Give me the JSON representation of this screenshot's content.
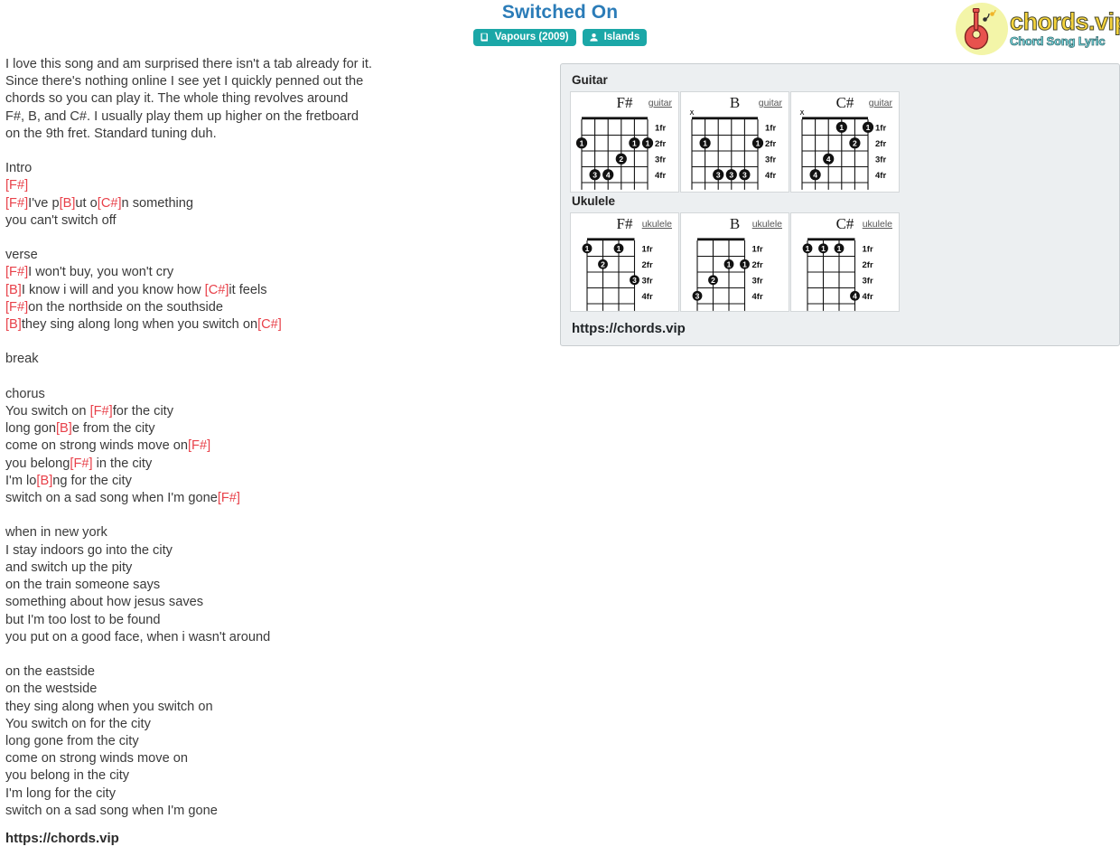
{
  "header": {
    "title": "Switched On",
    "badges": [
      {
        "icon": "album-icon",
        "label": "Vapours (2009)"
      },
      {
        "icon": "artist-icon",
        "label": "Islands"
      }
    ],
    "logo": {
      "icon": "guitar-icon",
      "name": "chords.vip",
      "tagline": "Chord Song Lyric"
    }
  },
  "lyrics": {
    "lines": [
      [
        {
          "t": "I love this song and am surprised there isn't a tab already for it.",
          "c": false
        }
      ],
      [
        {
          "t": "Since there's nothing online I see yet I quickly penned out the",
          "c": false
        }
      ],
      [
        {
          "t": "chords so you can play it. The whole thing revolves around",
          "c": false
        }
      ],
      [
        {
          "t": "F#, B, and C#. I usually play them up higher on the fretboard",
          "c": false
        }
      ],
      [
        {
          "t": "on the 9th fret. Standard tuning duh.",
          "c": false
        }
      ],
      [],
      [
        {
          "t": "Intro",
          "c": false
        }
      ],
      [
        {
          "t": "[F#]",
          "c": true
        }
      ],
      [
        {
          "t": "[F#]",
          "c": true
        },
        {
          "t": "I've p",
          "c": false
        },
        {
          "t": "[B]",
          "c": true
        },
        {
          "t": "ut o",
          "c": false
        },
        {
          "t": "[C#]",
          "c": true
        },
        {
          "t": "n something",
          "c": false
        }
      ],
      [
        {
          "t": "you can't switch off",
          "c": false
        }
      ],
      [],
      [
        {
          "t": "verse",
          "c": false
        }
      ],
      [
        {
          "t": "[F#]",
          "c": true
        },
        {
          "t": "I won't buy, you won't cry",
          "c": false
        }
      ],
      [
        {
          "t": "[B]",
          "c": true
        },
        {
          "t": "I know i will and you know how ",
          "c": false
        },
        {
          "t": "[C#]",
          "c": true
        },
        {
          "t": "it feels",
          "c": false
        }
      ],
      [
        {
          "t": "[F#]",
          "c": true
        },
        {
          "t": "on the northside on the southside",
          "c": false
        }
      ],
      [
        {
          "t": "[B]",
          "c": true
        },
        {
          "t": "they sing along long when you switch on",
          "c": false
        },
        {
          "t": "[C#]",
          "c": true
        }
      ],
      [],
      [
        {
          "t": "break",
          "c": false
        }
      ],
      [],
      [
        {
          "t": "chorus",
          "c": false
        }
      ],
      [
        {
          "t": "You switch on ",
          "c": false
        },
        {
          "t": "[F#]",
          "c": true
        },
        {
          "t": "for the city",
          "c": false
        }
      ],
      [
        {
          "t": "long gon",
          "c": false
        },
        {
          "t": "[B]",
          "c": true
        },
        {
          "t": "e from the city",
          "c": false
        }
      ],
      [
        {
          "t": "come on strong winds move on",
          "c": false
        },
        {
          "t": "[F#]",
          "c": true
        }
      ],
      [
        {
          "t": "you belong",
          "c": false
        },
        {
          "t": "[F#]",
          "c": true
        },
        {
          "t": " in the city",
          "c": false
        }
      ],
      [
        {
          "t": "I'm lo",
          "c": false
        },
        {
          "t": "[B]",
          "c": true
        },
        {
          "t": "ng for the city",
          "c": false
        }
      ],
      [
        {
          "t": "switch on a sad song when I'm gone",
          "c": false
        },
        {
          "t": "[F#]",
          "c": true
        }
      ],
      [],
      [
        {
          "t": "when in new york",
          "c": false
        }
      ],
      [
        {
          "t": "I stay indoors go into the city",
          "c": false
        }
      ],
      [
        {
          "t": "and switch up the pity",
          "c": false
        }
      ],
      [
        {
          "t": "on the train someone says",
          "c": false
        }
      ],
      [
        {
          "t": "something about how jesus saves",
          "c": false
        }
      ],
      [
        {
          "t": "but I'm too lost to be found",
          "c": false
        }
      ],
      [
        {
          "t": "you put on a good face, when i wasn't around",
          "c": false
        }
      ],
      [],
      [
        {
          "t": "on the eastside",
          "c": false
        }
      ],
      [
        {
          "t": "on the westside",
          "c": false
        }
      ],
      [
        {
          "t": "they sing along when you switch on",
          "c": false
        }
      ],
      [
        {
          "t": "You switch on for the city",
          "c": false
        }
      ],
      [
        {
          "t": "long gone from the city",
          "c": false
        }
      ],
      [
        {
          "t": "come on strong winds move on",
          "c": false
        }
      ],
      [
        {
          "t": "you belong in the city",
          "c": false
        }
      ],
      [
        {
          "t": "I'm long for the city",
          "c": false
        }
      ],
      [
        {
          "t": "switch on a sad song when I'm gone",
          "c": false
        }
      ]
    ],
    "footer_link": "https://chords.vip"
  },
  "chord_panel": {
    "footer_link": "https://chords.vip",
    "fret_labels": [
      "1fr",
      "2fr",
      "3fr",
      "4fr"
    ],
    "sections": [
      {
        "instrument_heading": "Guitar",
        "instrument_label": "guitar",
        "strings": 6,
        "chords": [
          {
            "name": "F#",
            "mutes": [],
            "dots": [
              {
                "string": 6,
                "fret": 2,
                "finger": "1"
              },
              {
                "string": 2,
                "fret": 2,
                "finger": "1"
              },
              {
                "string": 1,
                "fret": 2,
                "finger": "1"
              },
              {
                "string": 3,
                "fret": 3,
                "finger": "2"
              },
              {
                "string": 5,
                "fret": 4,
                "finger": "3"
              },
              {
                "string": 4,
                "fret": 4,
                "finger": "4"
              }
            ]
          },
          {
            "name": "B",
            "mutes": [
              6
            ],
            "dots": [
              {
                "string": 5,
                "fret": 2,
                "finger": "1"
              },
              {
                "string": 1,
                "fret": 2,
                "finger": "1"
              },
              {
                "string": 4,
                "fret": 4,
                "finger": "3"
              },
              {
                "string": 3,
                "fret": 4,
                "finger": "3"
              },
              {
                "string": 2,
                "fret": 4,
                "finger": "3"
              }
            ]
          },
          {
            "name": "C#",
            "mutes": [
              6
            ],
            "dots": [
              {
                "string": 3,
                "fret": 1,
                "finger": "1"
              },
              {
                "string": 1,
                "fret": 1,
                "finger": "1"
              },
              {
                "string": 2,
                "fret": 2,
                "finger": "2"
              },
              {
                "string": 4,
                "fret": 3,
                "finger": "4"
              },
              {
                "string": 5,
                "fret": 4,
                "finger": "4"
              }
            ]
          }
        ]
      },
      {
        "instrument_heading": "Ukulele",
        "instrument_label": "ukulele",
        "strings": 4,
        "chords": [
          {
            "name": "F#",
            "mutes": [],
            "dots": [
              {
                "string": 4,
                "fret": 1,
                "finger": "1"
              },
              {
                "string": 2,
                "fret": 1,
                "finger": "1"
              },
              {
                "string": 3,
                "fret": 2,
                "finger": "2"
              },
              {
                "string": 1,
                "fret": 3,
                "finger": "3"
              }
            ]
          },
          {
            "name": "B",
            "mutes": [],
            "dots": [
              {
                "string": 2,
                "fret": 2,
                "finger": "1"
              },
              {
                "string": 1,
                "fret": 2,
                "finger": "1"
              },
              {
                "string": 3,
                "fret": 3,
                "finger": "2"
              },
              {
                "string": 4,
                "fret": 4,
                "finger": "3"
              }
            ]
          },
          {
            "name": "C#",
            "mutes": [],
            "dots": [
              {
                "string": 4,
                "fret": 1,
                "finger": "1"
              },
              {
                "string": 3,
                "fret": 1,
                "finger": "1"
              },
              {
                "string": 2,
                "fret": 1,
                "finger": "1"
              },
              {
                "string": 1,
                "fret": 4,
                "finger": "4"
              }
            ]
          }
        ]
      }
    ]
  }
}
